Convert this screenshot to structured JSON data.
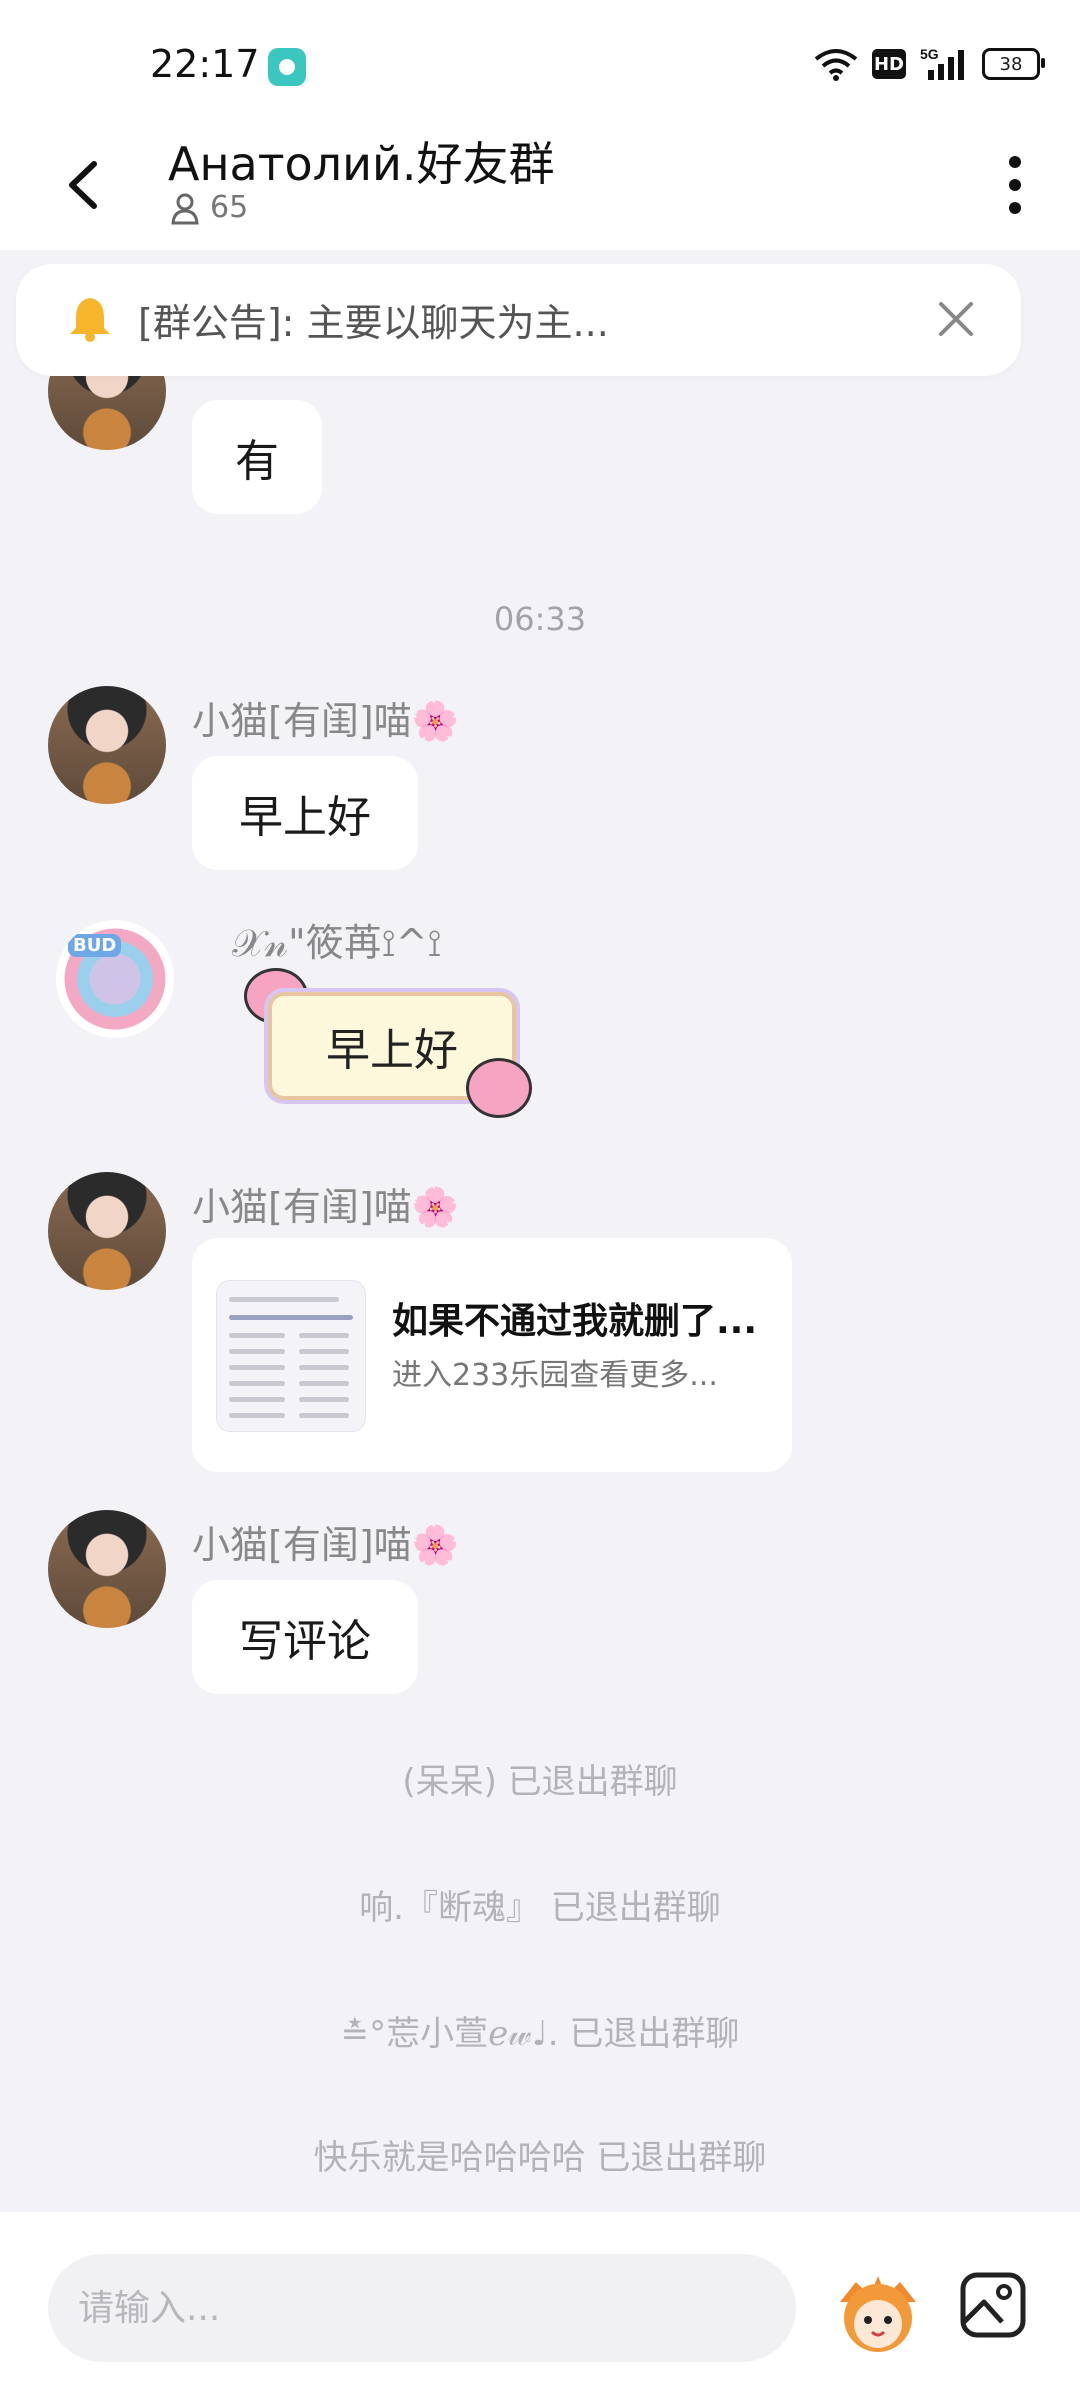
{
  "status_bar": {
    "time": "22:17",
    "hd": "HD",
    "network": "5G",
    "battery": "38"
  },
  "header": {
    "title": "Анатолий.好友群",
    "member_count": "65"
  },
  "announcement": {
    "text": "[群公告]: 主要以聊天为主..."
  },
  "messages": [
    {
      "type": "text",
      "text": "有"
    },
    {
      "type": "time",
      "text": "06:33"
    },
    {
      "type": "text",
      "sender": "小猫[有闺]喵🌸",
      "text": "早上好"
    },
    {
      "type": "sticker",
      "sender": "𝒳𝓃\"筱苒⟟^⟟",
      "text": "早上好"
    },
    {
      "type": "card",
      "sender": "小猫[有闺]喵🌸",
      "title": "如果不通过我就删了...",
      "subtitle": "进入233乐园查看更多..."
    },
    {
      "type": "text",
      "sender": "小猫[有闺]喵🌸",
      "text": "写评论"
    }
  ],
  "system_messages": [
    "(呆呆) 已退出群聊",
    "响.『断魂』 已退出群聊",
    "≛°莣小萱ℯ𝓌♩. 已退出群聊",
    "快乐就是哈哈哈哈 已退出群聊"
  ],
  "input": {
    "placeholder": "请输入..."
  },
  "icons": {
    "back": "back-arrow-icon",
    "more": "more-vertical-icon",
    "bell": "bell-icon",
    "close": "close-icon",
    "emoji": "emoji-icon",
    "image": "image-icon"
  },
  "colors": {
    "background": "#f2f2f7",
    "bubble": "#ffffff",
    "bell": "#f7b52c"
  }
}
